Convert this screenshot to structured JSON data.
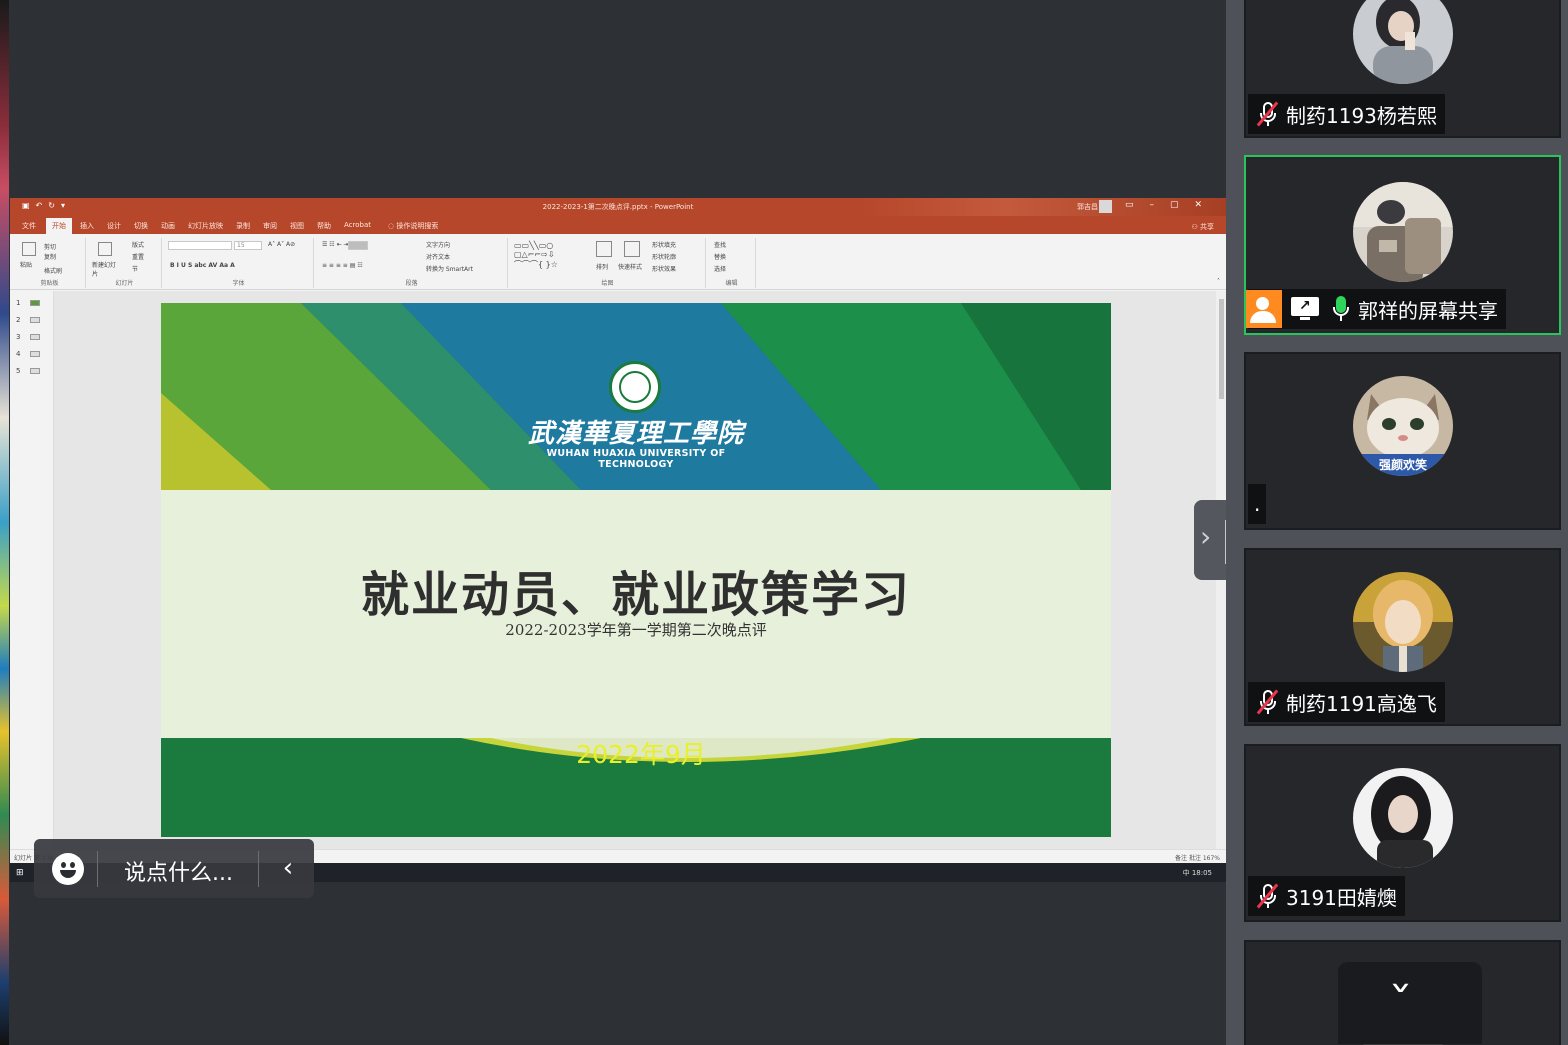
{
  "ppt": {
    "window_title": "2022-2023-1第二次晚点评.pptx - PowerPoint",
    "user_name": "郭吉昌",
    "tabs": [
      "文件",
      "开始",
      "插入",
      "设计",
      "切换",
      "动画",
      "幻灯片放映",
      "录制",
      "审阅",
      "视图",
      "帮助",
      "Acrobat"
    ],
    "search_label": "操作说明搜索",
    "share_label": "共享",
    "ribbon": {
      "paste": "粘贴",
      "cut": "剪切",
      "copy": "复制",
      "format_painter": "格式刷",
      "clipboard_group": "剪贴板",
      "new_slide": "新建幻灯片",
      "layout": "版式",
      "reset": "重置",
      "section": "节",
      "slides_group": "幻灯片",
      "font_group": "字体",
      "paragraph_group": "段落",
      "text_direction": "文字方向",
      "align_text": "对齐文本",
      "convert_smartart": "转换为 SmartArt",
      "arrange": "排列",
      "quick_styles": "快速样式",
      "shape_fill": "形状填充",
      "shape_outline": "形状轮廓",
      "shape_effects": "形状效果",
      "drawing_group": "绘图",
      "find": "查找",
      "replace": "替换",
      "select": "选择",
      "editing_group": "编辑",
      "font_size": "15"
    },
    "thumbnails": [
      "1",
      "2",
      "3",
      "4",
      "5"
    ],
    "status_left": "幻灯片 第 1 张，共 5 张",
    "status_right": "备注  批注          167%",
    "taskbar_time": "18:05",
    "taskbar_ime": "中"
  },
  "slide": {
    "school_cn": "武漢華夏理工學院",
    "school_en": "WUHAN HUAXIA UNIVERSITY OF TECHNOLOGY",
    "title": "就业动员、就业政策学习",
    "subtitle": "2022-2023学年第一学期第二次晚点评",
    "date": "2022年9月"
  },
  "chat": {
    "placeholder": "说点什么..."
  },
  "participants": [
    {
      "name": "制药1193杨若熙",
      "mic": "muted",
      "avatar": "photo-girl-sweater"
    },
    {
      "name": "郭祥的屏幕共享",
      "mic": "on",
      "host": true,
      "sharing": true,
      "avatar": "illustration-backpacker"
    },
    {
      "name": ".",
      "mic": "none",
      "avatar": "cat-meme"
    },
    {
      "name": "制药1191高逸飞",
      "mic": "muted",
      "avatar": "anime-girl"
    },
    {
      "name": "3191田婧燠",
      "mic": "muted",
      "avatar": "photo-woman-dark-hair"
    }
  ],
  "cat_caption": "强颜欢笑",
  "colors": {
    "ppt_accent": "#b7472a",
    "slide_green": "#1b7a3e",
    "active_border": "#29c45a",
    "date_yellow": "#e8f02a"
  }
}
